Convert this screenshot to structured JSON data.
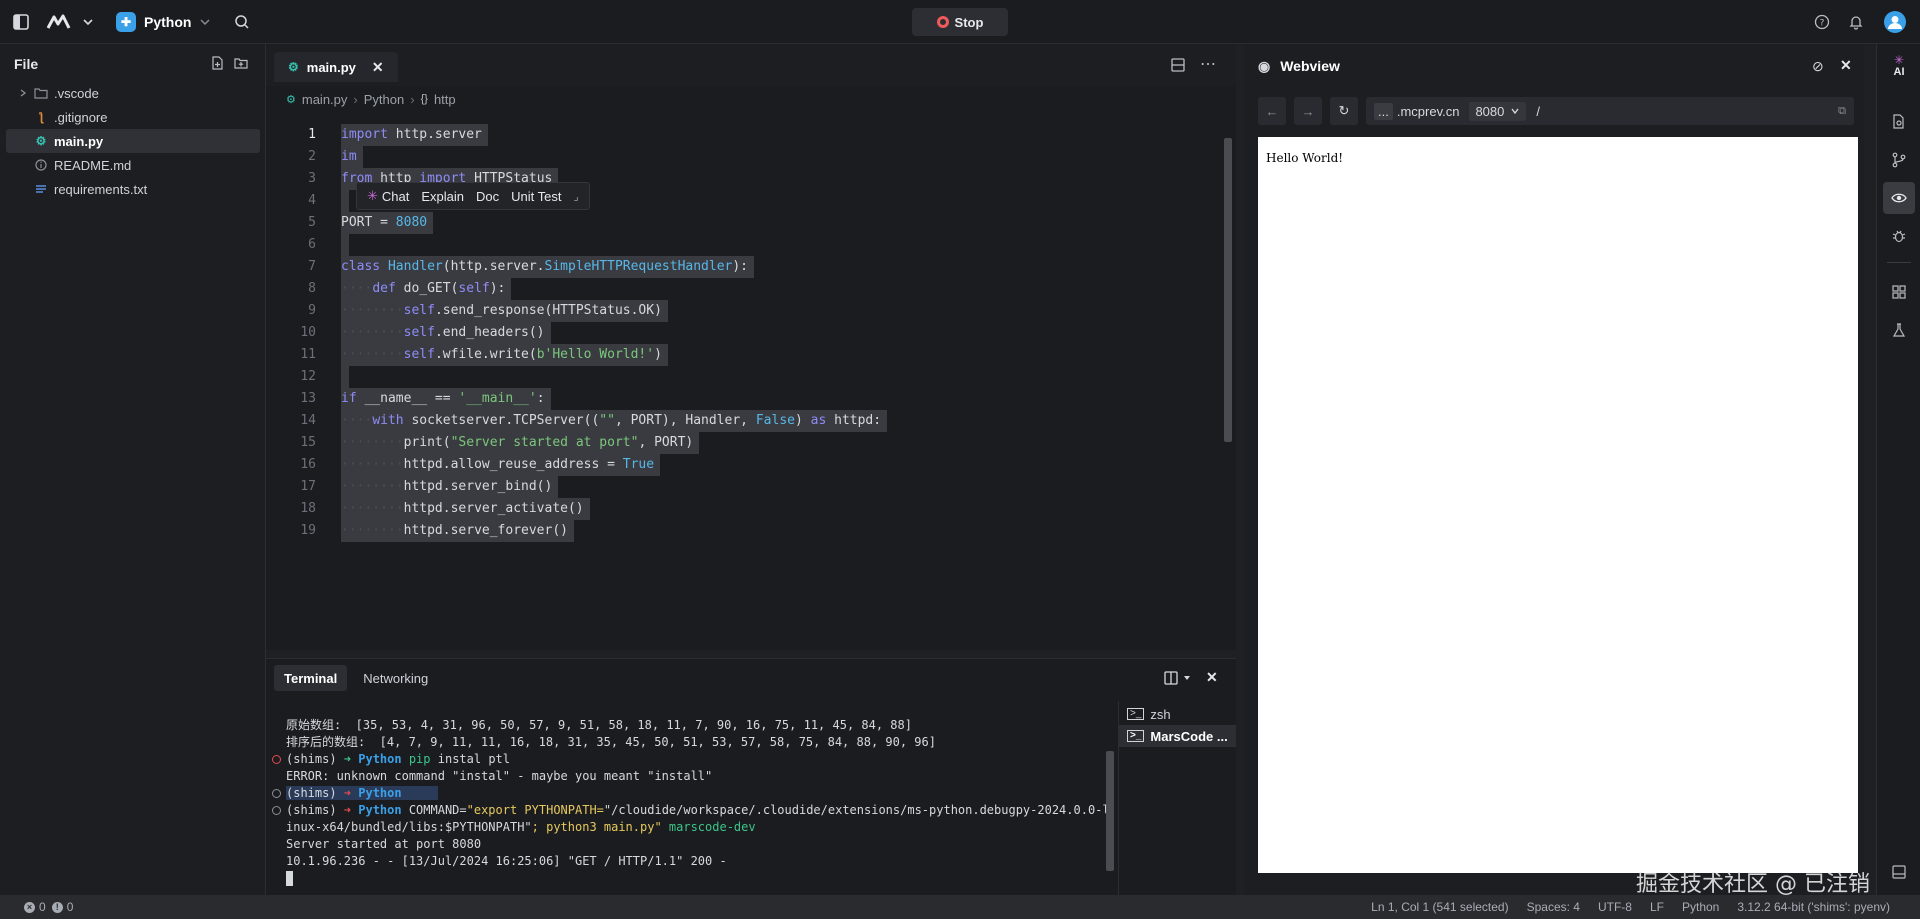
{
  "topbar": {
    "project_name": "Python",
    "stop_label": "Stop",
    "accent_color": "#3aa0e8"
  },
  "explorer": {
    "title": "File",
    "items": [
      {
        "label": ".vscode",
        "icon": "folder-icon"
      },
      {
        "label": ".gitignore",
        "icon": "git-icon"
      },
      {
        "label": "main.py",
        "icon": "python-icon"
      },
      {
        "label": "README.md",
        "icon": "info-icon"
      },
      {
        "label": "requirements.txt",
        "icon": "list-icon"
      }
    ]
  },
  "editor": {
    "tab_label": "main.py",
    "breadcrumb": [
      "main.py",
      "Python",
      "http"
    ],
    "ai_popup": [
      "Chat",
      "Explain",
      "Doc",
      "Unit Test"
    ],
    "line_numbers": [
      "1",
      "2",
      "3",
      "4",
      "5",
      "6",
      "7",
      "8",
      "9",
      "10",
      "11",
      "12",
      "13",
      "14",
      "15",
      "16",
      "17",
      "18",
      "19"
    ]
  },
  "terminal": {
    "tabs": [
      "Terminal",
      "Networking"
    ],
    "sessions": [
      "zsh",
      "MarsCode ..."
    ],
    "lines": [
      "原始数组:  [35, 53, 4, 31, 96, 50, 57, 9, 51, 58, 18, 11, 7, 90, 16, 75, 11, 45, 84, 88]",
      "排序后的数组:  [4, 7, 9, 11, 11, 16, 18, 31, 35, 45, 50, 51, 53, 57, 58, 75, 84, 88, 90, 96]",
      "(shims) ➜ Python pip instal ptl",
      "ERROR: unknown command \"instal\" - maybe you meant \"install\"",
      "(shims) ➜ Python",
      "(shims) ➜ Python COMMAND=\"export PYTHONPATH=\"/cloudide/workspace/.cloudide/extensions/ms-python.debugpy-2024.0.0-l",
      "inux-x64/bundled/libs:$PYTHONPATH\"; python3 main.py\" marscode-dev",
      "Server started at port 8080",
      "10.1.96.236 - - [13/Jul/2024 16:25:06] \"GET / HTTP/1.1\" 200 -"
    ]
  },
  "webview": {
    "title": "Webview",
    "host_prefix": "...",
    "host": ".mcprev.cn",
    "port": "8080",
    "path": "/",
    "page_text": "Hello World!"
  },
  "rail": {
    "ai_label": "AI"
  },
  "status": {
    "problems_errors": "0",
    "problems_warnings": "0",
    "cursor": "Ln 1, Col 1 (541 selected)",
    "spaces": "Spaces: 4",
    "encoding": "UTF-8",
    "eol": "LF",
    "language": "Python",
    "interpreter": "3.12.2 64-bit ('shims': pyenv)"
  },
  "watermark": "掘金技术社区 @ 已注销"
}
